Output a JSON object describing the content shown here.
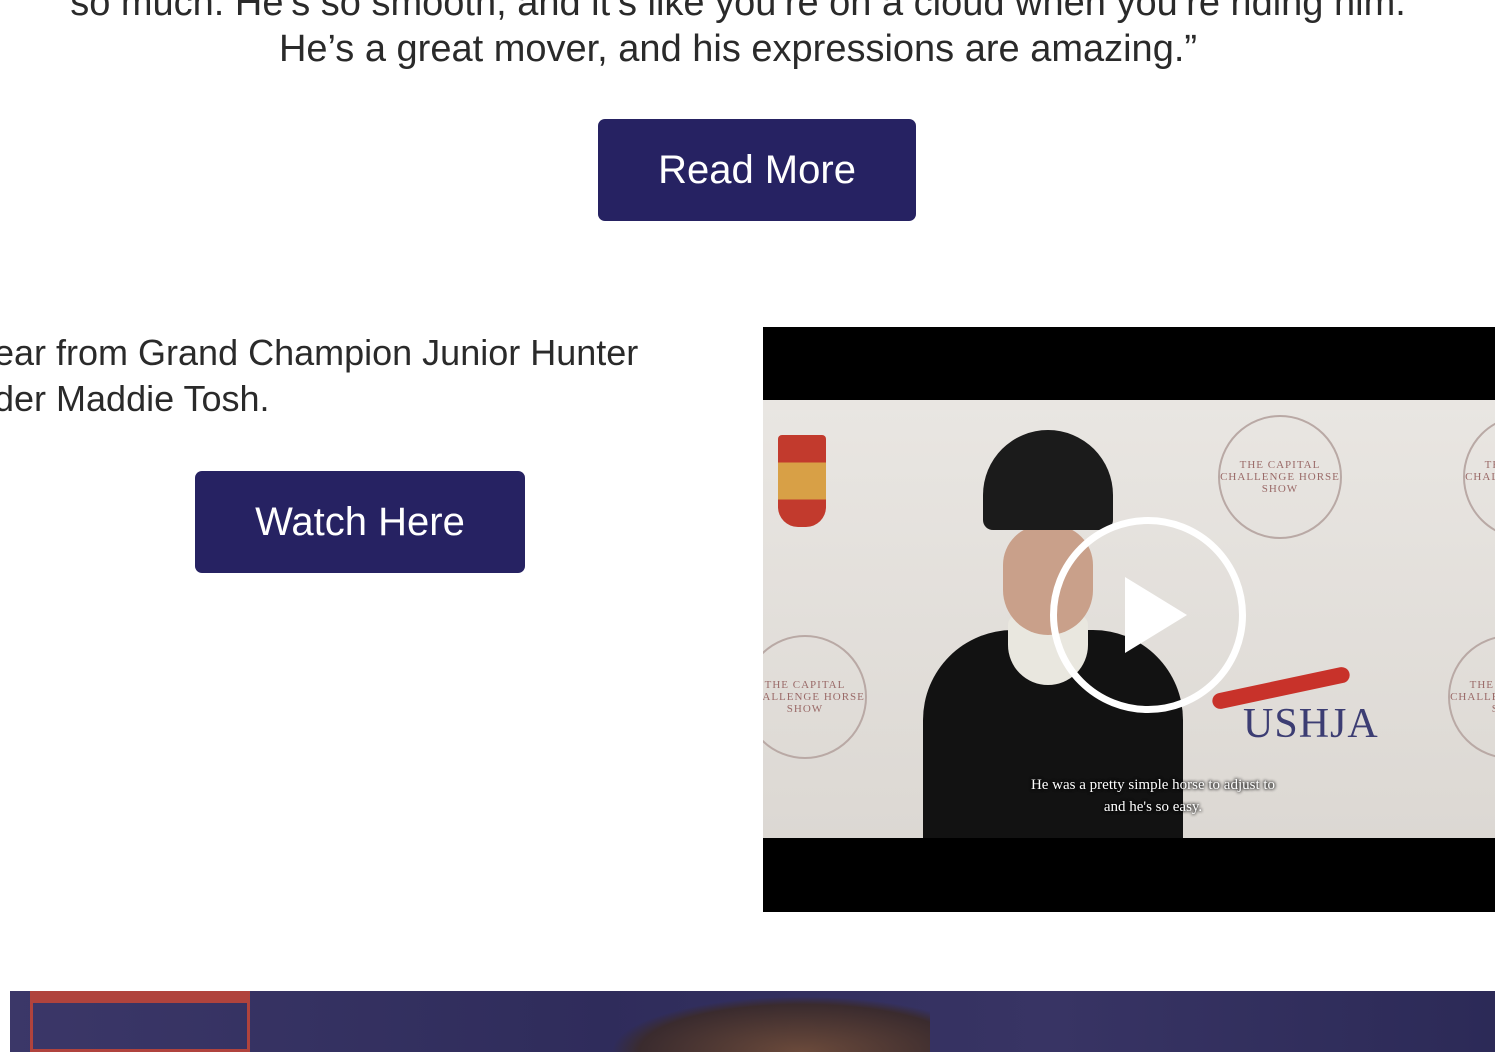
{
  "quote": {
    "line1": "so much. He’s so smooth, and it’s like you’re on a cloud when you’re riding him.",
    "line2": "He’s a great mover, and his expressions are amazing.”"
  },
  "read_more": {
    "label": "Read More"
  },
  "intro": {
    "line1": "ear from Grand Champion Junior Hunter",
    "line2": "der Maddie Tosh."
  },
  "watch_here": {
    "label": "Watch Here"
  },
  "video": {
    "caption_line1": "He was a pretty simple horse to adjust to",
    "caption_line2": "and he's so easy.",
    "logo_text": "USHJA",
    "seal_text": "THE CAPITAL CHALLENGE HORSE SHOW",
    "play_icon": "play-icon"
  },
  "colors": {
    "button_bg": "#262262",
    "text": "#2a2a2a"
  }
}
